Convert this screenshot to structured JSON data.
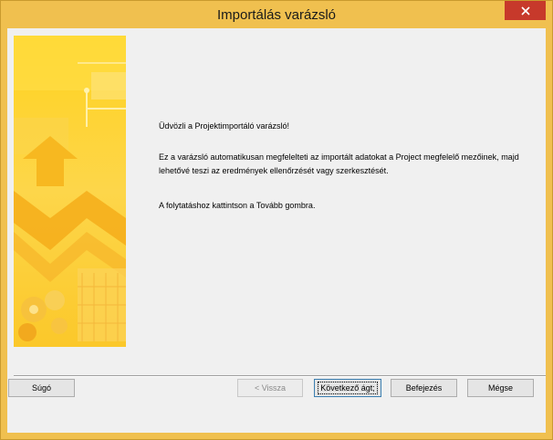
{
  "window": {
    "title": "Importálás varázsló"
  },
  "wizard": {
    "welcome": "Üdvözli a Projektimportáló varázsló!",
    "description": "Ez a varázsló automatikusan megfelelteti az importált adatokat a Project megfelelő mezőinek, majd lehetővé teszi az eredmények ellenőrzését vagy szerkesztését.",
    "instruction": "A folytatáshoz kattintson a Tovább gombra."
  },
  "buttons": {
    "help": "Súgó",
    "back": "< Vissza",
    "next": "Következő ágt;",
    "finish": "Befejezés",
    "cancel": "Mégse"
  },
  "colors": {
    "frame": "#f0c04f",
    "close": "#c7392b",
    "client": "#f0f0f0"
  },
  "icons": [
    "close-icon",
    "wizard-banner-graphic"
  ]
}
